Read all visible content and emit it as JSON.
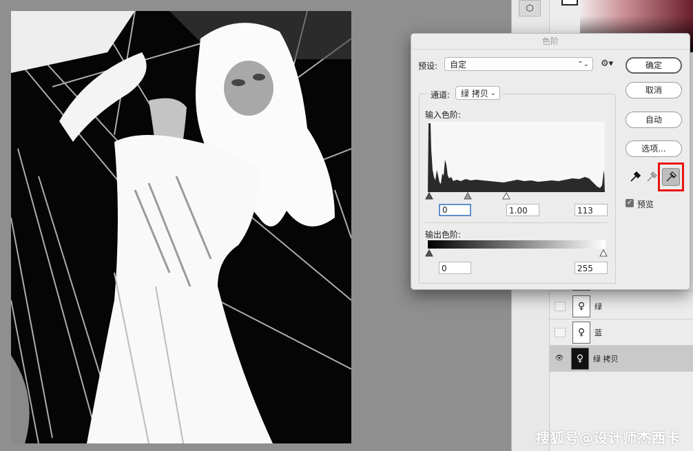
{
  "dialog": {
    "title": "色阶",
    "preset_label": "预设:",
    "preset_value": "自定",
    "channel_label": "通道:",
    "channel_value": "绿 拷贝",
    "input_label": "输入色阶:",
    "output_label": "输出色阶:",
    "input_black": "0",
    "input_gamma": "1.00",
    "input_white": "113",
    "output_black": "0",
    "output_white": "255",
    "buttons": {
      "ok": "确定",
      "cancel": "取消",
      "auto": "自动",
      "options": "选项..."
    },
    "preview_label": "预览",
    "preview_checked": true,
    "gear_icon": "gear-icon",
    "eyedroppers": [
      "black-eyedropper-icon",
      "gray-eyedropper-icon",
      "white-eyedropper-icon"
    ],
    "highlight_color": "#e8120d"
  },
  "layers": [
    {
      "name": "绿",
      "visible": false
    },
    {
      "name": "蓝",
      "visible": false
    },
    {
      "name": "绿 拷贝",
      "visible": true,
      "selected": true
    }
  ],
  "watermark": "搜狐号@设计师杰西卡"
}
